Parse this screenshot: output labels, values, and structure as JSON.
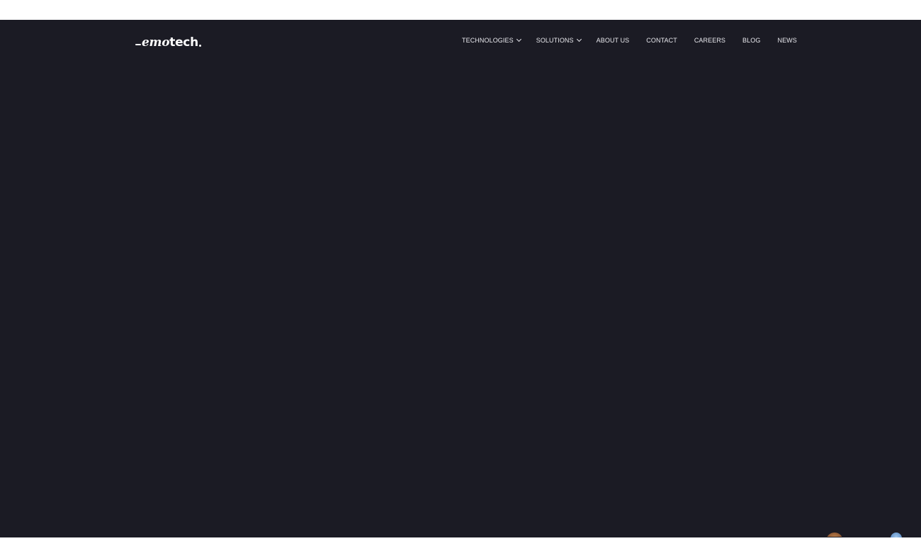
{
  "header": {
    "logo": {
      "prefix": "",
      "script": "emo",
      "suffix": "tech"
    },
    "nav": [
      {
        "label": "TECHNOLOGIES",
        "dropdown": true
      },
      {
        "label": "SOLUTIONS",
        "dropdown": true
      },
      {
        "label": "ABOUT US",
        "dropdown": false
      },
      {
        "label": "CONTACT",
        "dropdown": false
      },
      {
        "label": "CAREERS",
        "dropdown": false
      },
      {
        "label": "BLOG",
        "dropdown": false
      },
      {
        "label": "NEWS",
        "dropdown": false
      }
    ]
  },
  "colors": {
    "hero_background": "#1b1b24",
    "nav_text": "#e9e9ee",
    "page_background": "#ffffff"
  },
  "icons": [
    "chevron-down-icon",
    "avatar"
  ]
}
